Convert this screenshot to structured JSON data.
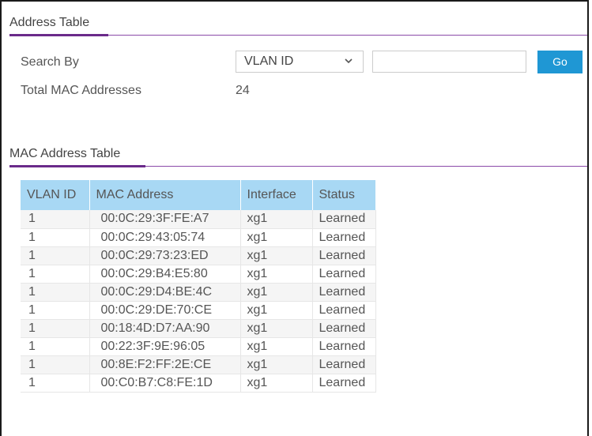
{
  "address_table": {
    "title": "Address Table",
    "search_by_label": "Search By",
    "search_by_selected": "VLAN ID",
    "search_input_value": "",
    "search_input_placeholder": "",
    "go_label": "Go",
    "total_label": "Total MAC Addresses",
    "total_value": "24"
  },
  "mac_table": {
    "title": "MAC Address Table",
    "columns": [
      "VLAN ID",
      "MAC Address",
      "Interface",
      "Status"
    ],
    "rows": [
      {
        "vlan": "1",
        "mac": "00:0C:29:3F:FE:A7",
        "iface": "xg1",
        "status": "Learned"
      },
      {
        "vlan": "1",
        "mac": "00:0C:29:43:05:74",
        "iface": "xg1",
        "status": "Learned"
      },
      {
        "vlan": "1",
        "mac": "00:0C:29:73:23:ED",
        "iface": "xg1",
        "status": "Learned"
      },
      {
        "vlan": "1",
        "mac": "00:0C:29:B4:E5:80",
        "iface": "xg1",
        "status": "Learned"
      },
      {
        "vlan": "1",
        "mac": "00:0C:29:D4:BE:4C",
        "iface": "xg1",
        "status": "Learned"
      },
      {
        "vlan": "1",
        "mac": "00:0C:29:DE:70:CE",
        "iface": "xg1",
        "status": "Learned"
      },
      {
        "vlan": "1",
        "mac": "00:18:4D:D7:AA:90",
        "iface": "xg1",
        "status": "Learned"
      },
      {
        "vlan": "1",
        "mac": "00:22:3F:9E:96:05",
        "iface": "xg1",
        "status": "Learned"
      },
      {
        "vlan": "1",
        "mac": "00:8E:F2:FF:2E:CE",
        "iface": "xg1",
        "status": "Learned"
      },
      {
        "vlan": "1",
        "mac": "00:C0:B7:C8:FE:1D",
        "iface": "xg1",
        "status": "Learned"
      }
    ]
  },
  "colors": {
    "accent_purple": "#6a2a8a",
    "header_blue": "#a8d8f4",
    "button_blue": "#1f97d4"
  }
}
